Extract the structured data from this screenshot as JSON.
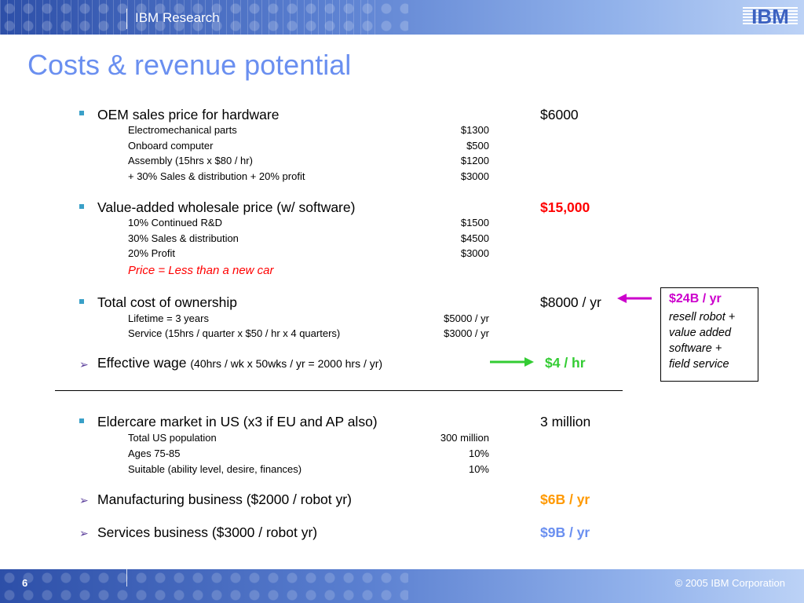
{
  "header": {
    "org": "IBM Research",
    "logo_text": "IBM"
  },
  "title": "Costs & revenue potential",
  "oem": {
    "label": "OEM sales price for hardware",
    "total": "$6000",
    "items": [
      {
        "label": "Electromechanical parts",
        "value": "$1300"
      },
      {
        "label": "Onboard computer",
        "value": "$500"
      },
      {
        "label": "Assembly (15hrs x $80 / hr)",
        "value": "$1200"
      },
      {
        "label": "+ 30% Sales & distribution + 20% profit",
        "value": "$3000"
      }
    ]
  },
  "wholesale": {
    "label": "Value-added wholesale price (w/ software)",
    "total": "$15,000",
    "items": [
      {
        "label": "10% Continued R&D",
        "value": "$1500"
      },
      {
        "label": "30% Sales & distribution",
        "value": "$4500"
      },
      {
        "label": "20% Profit",
        "value": "$3000"
      }
    ],
    "note": "Price = Less than a new car"
  },
  "tco": {
    "label": "Total cost of ownership",
    "total": "$8000 / yr",
    "items": [
      {
        "label": "Lifetime = 3 years",
        "value": "$5000 / yr"
      },
      {
        "label": "Service (15hrs / quarter x $50 / hr x 4 quarters)",
        "value": "$3000 / yr"
      }
    ]
  },
  "wage": {
    "label": "Effective wage",
    "detail": "(40hrs / wk x 50wks / yr = 2000 hrs / yr)",
    "total": "$4 / hr"
  },
  "callout": {
    "title": "$24B / yr",
    "body": [
      "resell robot +",
      "value added",
      "software +",
      "field service"
    ]
  },
  "market": {
    "label": "Eldercare market in US (x3 if EU and AP also)",
    "total": "3 million",
    "items": [
      {
        "label": "Total US population",
        "value": "300 million"
      },
      {
        "label": "Ages 75-85",
        "value": "10%"
      },
      {
        "label": "Suitable (ability level, desire, finances)",
        "value": "10%"
      }
    ]
  },
  "manufacturing": {
    "label": "Manufacturing business ($2000 / robot yr)",
    "total": "$6B / yr"
  },
  "services": {
    "label": "Services business ($3000 / robot yr)",
    "total": "$9B / yr"
  },
  "footer": {
    "page": "6",
    "copyright": "© 2005 IBM Corporation"
  },
  "colors": {
    "title": "#6a8ff0",
    "red": "#ff0000",
    "orange": "#ff9900",
    "green": "#33cc33",
    "magenta": "#cc00cc",
    "bullet": "#3aa0c8"
  }
}
